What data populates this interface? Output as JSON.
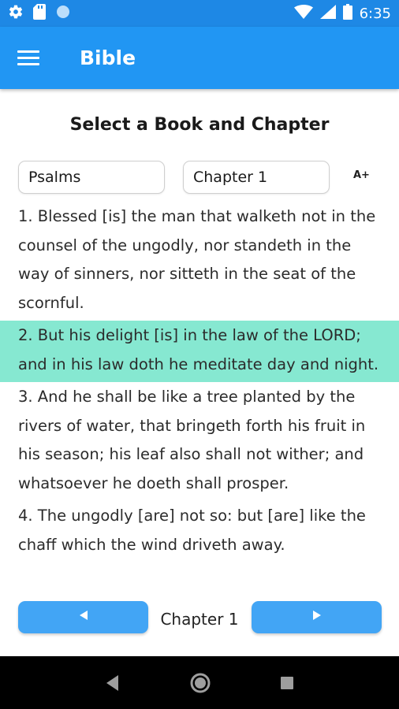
{
  "status_bar": {
    "time": "6:35",
    "icons": [
      "gear-icon",
      "sd-card-icon",
      "circle-icon",
      "wifi-icon",
      "signal-icon",
      "battery-icon"
    ]
  },
  "app_bar": {
    "title": "Bible",
    "icons": [
      "menu-icon"
    ],
    "color": "#2196f3"
  },
  "selector": {
    "heading": "Select a Book and Chapter",
    "book": "Psalms",
    "chapter": "Chapter 1",
    "font_size_button": "A+"
  },
  "verses": [
    {
      "text": "1. Blessed [is] the man that walketh not in the counsel of the ungodly, nor standeth in the way of sinners, nor sitteth in the seat of the scornful.",
      "highlighted": false
    },
    {
      "text": "2. But his delight [is] in the law of the LORD; and in his law doth he meditate day and night.",
      "highlighted": true
    },
    {
      "text": "3. And he shall be like a tree planted by the rivers of water, that bringeth forth his fruit in his season; his leaf also shall not wither; and whatsoever he doeth shall prosper.",
      "highlighted": false
    },
    {
      "text": "4. The ungodly [are] not so: but [are] like the chaff which the wind driveth away.",
      "highlighted": false
    }
  ],
  "bottom_nav": {
    "chapter_label": "Chapter 1",
    "prev_icon": "triangle-left-icon",
    "next_icon": "triangle-right-icon"
  },
  "system_nav": {
    "icons": [
      "back-icon",
      "home-icon",
      "recents-icon"
    ]
  },
  "colors": {
    "status_bar": "#1e88e5",
    "app_bar": "#2196f3",
    "highlight": "#86e8d1",
    "nav_button": "#42a5f5"
  }
}
